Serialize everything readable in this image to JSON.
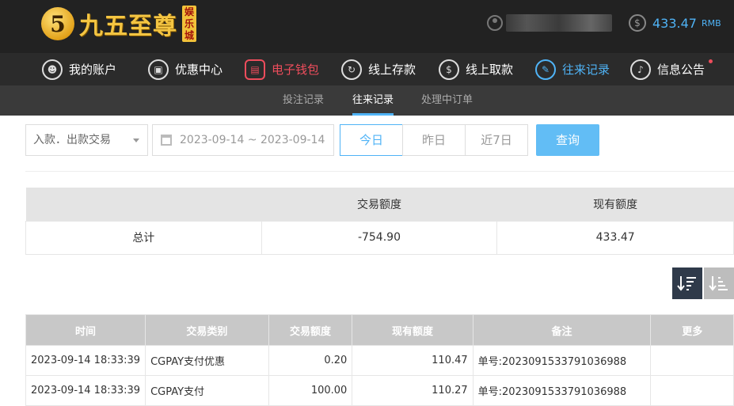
{
  "header": {
    "logo_mark": "5",
    "logo_text": "九五至尊",
    "logo_badge": "娱乐城",
    "balance_value": "433.47",
    "balance_unit": "RMB"
  },
  "nav": [
    {
      "label": "我的账户",
      "icon": "user-icon"
    },
    {
      "label": "优惠中心",
      "icon": "gift-icon"
    },
    {
      "label": "电子钱包",
      "icon": "wallet-icon"
    },
    {
      "label": "线上存款",
      "icon": "deposit-icon"
    },
    {
      "label": "线上取款",
      "icon": "withdraw-icon"
    },
    {
      "label": "往来记录",
      "icon": "records-icon"
    },
    {
      "label": "信息公告",
      "icon": "bell-icon"
    }
  ],
  "subnav": [
    "投注记录",
    "往来记录",
    "处理中订单"
  ],
  "filters": {
    "type_select": "入款．出款交易",
    "date_range": "2023-09-14 ~ 2023-09-14",
    "today": "今日",
    "yesterday": "昨日",
    "last7": "近7日",
    "query": "查询"
  },
  "summary": {
    "headers": [
      "",
      "交易额度",
      "现有额度"
    ],
    "row": [
      "总计",
      "-754.90",
      "433.47"
    ]
  },
  "detail": {
    "headers": [
      "时间",
      "交易类别",
      "交易额度",
      "现有额度",
      "备注",
      "更多"
    ],
    "rows": [
      [
        "2023-09-14 18:33:39",
        "CGPAY支付优惠",
        "0.20",
        "110.47",
        "单号:2023091533791036988",
        ""
      ],
      [
        "2023-09-14 18:33:39",
        "CGPAY支付",
        "100.00",
        "110.27",
        "单号:2023091533791036988",
        ""
      ]
    ]
  },
  "colors": {
    "accent_blue": "#4fb3f6",
    "accent_red": "#ee4d5c",
    "gold": "#f4c542"
  }
}
